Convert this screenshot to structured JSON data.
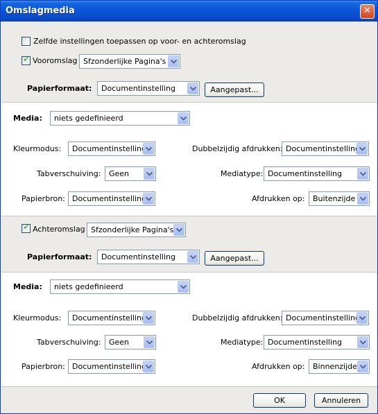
{
  "window": {
    "title": "Omslagmedia"
  },
  "top": {
    "same_settings_label": "Zelfde instellingen toepassen op voor- en achteromslag",
    "same_settings_checked": false,
    "front_cover_label": "Vooromslag",
    "front_cover_checked": true,
    "front_cover_select": "Sfzonderlijke Pagina's",
    "paper_format_label": "Papierformaat:",
    "paper_format_value": "Documentinstelling",
    "custom_button": "Aangepast..."
  },
  "front": {
    "media_label": "Media:",
    "media_value": "niets gedefinieerd",
    "color_mode_label": "Kleurmodus:",
    "color_mode_value": "Documentinstelling",
    "duplex_label": "Dubbelzijdig afdrukken:",
    "duplex_value": "Documentinstelling",
    "tab_shift_label": "Tabverschuiving:",
    "tab_shift_value": "Geen",
    "media_type_label": "Mediatype:",
    "media_type_value": "Documentinstelling",
    "paper_source_label": "Papierbron:",
    "paper_source_value": "Documentinstelling",
    "print_on_label": "Afdrukken op:",
    "print_on_value": "Buitenzijde"
  },
  "back_top": {
    "back_cover_label": "Achteromslag",
    "back_cover_checked": true,
    "back_cover_select": "Sfzonderlijke Pagina's",
    "paper_format_label": "Papierformaat:",
    "paper_format_value": "Documentinstelling",
    "custom_button": "Aangepast..."
  },
  "back": {
    "media_label": "Media:",
    "media_value": "niets gedefinieerd",
    "color_mode_label": "Kleurmodus:",
    "color_mode_value": "Documentinstelling",
    "duplex_label": "Dubbelzijdig afdrukken:",
    "duplex_value": "Documentinstelling",
    "tab_shift_label": "Tabverschuiving:",
    "tab_shift_value": "Geen",
    "media_type_label": "Mediatype:",
    "media_type_value": "Documentinstelling",
    "paper_source_label": "Papierbron:",
    "paper_source_value": "Documentinstelling",
    "print_on_label": "Afdrukken op:",
    "print_on_value": "Binnenzijde"
  },
  "footer": {
    "ok": "OK",
    "cancel": "Annuleren"
  },
  "colors": {
    "titlebar": "#0a55d8",
    "check": "#21a121",
    "field_border": "#7f9db9"
  }
}
